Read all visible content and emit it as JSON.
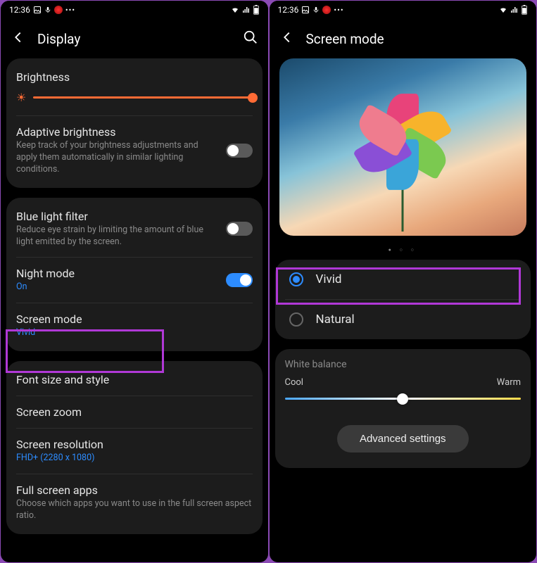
{
  "status": {
    "time": "12:36"
  },
  "left": {
    "title": "Display",
    "brightness": {
      "label": "Brightness"
    },
    "adaptive": {
      "label": "Adaptive brightness",
      "sub": "Keep track of your brightness adjustments and apply them automatically in similar lighting conditions."
    },
    "bluelight": {
      "label": "Blue light filter",
      "sub": "Reduce eye strain by limiting the amount of blue light emitted by the screen."
    },
    "night": {
      "label": "Night mode",
      "sub": "On"
    },
    "screenmode": {
      "label": "Screen mode",
      "sub": "Vivid"
    },
    "fontsize": {
      "label": "Font size and style"
    },
    "zoom": {
      "label": "Screen zoom"
    },
    "resolution": {
      "label": "Screen resolution",
      "sub": "FHD+ (2280 x 1080)"
    },
    "fullscreen": {
      "label": "Full screen apps",
      "sub": "Choose which apps you want to use in the full screen aspect ratio."
    }
  },
  "right": {
    "title": "Screen mode",
    "vivid": "Vivid",
    "natural": "Natural",
    "wb": {
      "label": "White balance",
      "cool": "Cool",
      "warm": "Warm"
    },
    "advanced": "Advanced settings"
  }
}
